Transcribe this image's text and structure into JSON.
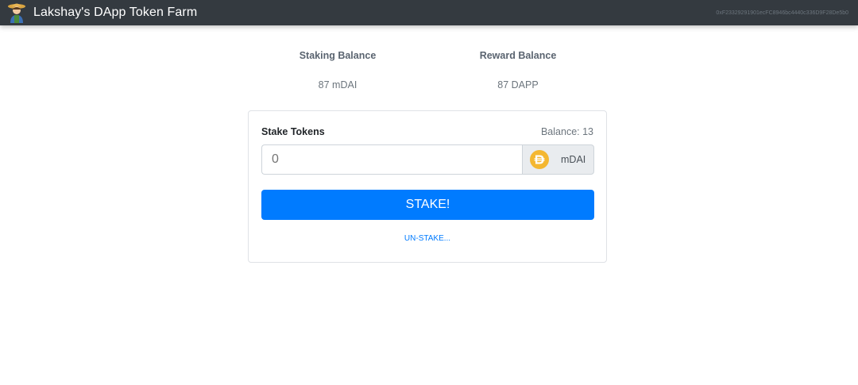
{
  "header": {
    "title": "Lakshay's DApp Token Farm",
    "account": "0xF23329291901ecFC8946bc4440c336D9F28De5b0",
    "logo_icon": "farmer-icon"
  },
  "balances": {
    "staking_label": "Staking Balance",
    "staking_value": "87 mDAI",
    "reward_label": "Reward Balance",
    "reward_value": "87 DAPP"
  },
  "stake_form": {
    "title": "Stake Tokens",
    "balance_text": "Balance: 13",
    "amount_placeholder": "0",
    "token_icon": "dai-icon",
    "token_label": "mDAI",
    "stake_button": "STAKE!",
    "unstake_link": "UN-STAKE..."
  },
  "colors": {
    "navbar": "#343a40",
    "primary": "#007bff",
    "dai_gold": "#f4b731"
  }
}
